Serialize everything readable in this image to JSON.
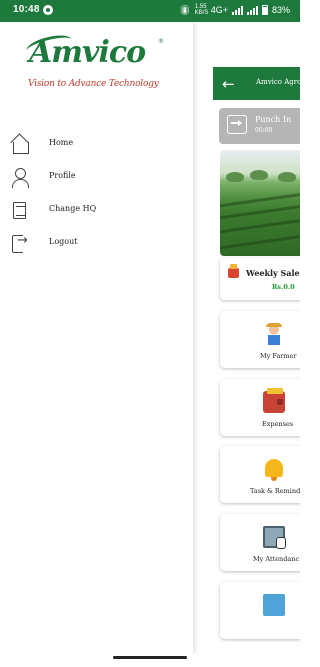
{
  "status_bar": {
    "time": "10:48",
    "speed": "1.55 KB/S",
    "network": "4G+",
    "battery": "83%",
    "icons": [
      "whatsapp-icon",
      "vibrate-icon",
      "signal-icon",
      "battery-icon"
    ]
  },
  "drawer": {
    "logo": {
      "brand": "Amvico",
      "registered": "®",
      "tagline": "Vision to Advance Technology"
    },
    "items": [
      {
        "label": "Home",
        "icon": "home-icon"
      },
      {
        "label": "Profile",
        "icon": "profile-icon"
      },
      {
        "label": "Change HQ",
        "icon": "change-hq-icon"
      },
      {
        "label": "Logout",
        "icon": "logout-icon"
      }
    ]
  },
  "app": {
    "title": "Amvico Agro",
    "back_icon": "back-arrow-icon",
    "punch": {
      "label": "Punch In",
      "time": "00:00"
    },
    "weekly_sales": {
      "title": "Weekly Sales",
      "value": "Rs.0.0"
    },
    "tiles": [
      {
        "label": "My Farmer",
        "icon": "farmer-icon"
      },
      {
        "label": "Expenses",
        "icon": "wallet-icon"
      },
      {
        "label": "Task & Remind",
        "icon": "bell-icon"
      },
      {
        "label": "My Attendanc",
        "icon": "attendance-icon"
      }
    ]
  },
  "colors": {
    "brand_green": "#1e7a3c",
    "tagline_red": "#c0392b",
    "sales_green": "#1c9a2e",
    "punch_gray": "#b5b5b5"
  }
}
